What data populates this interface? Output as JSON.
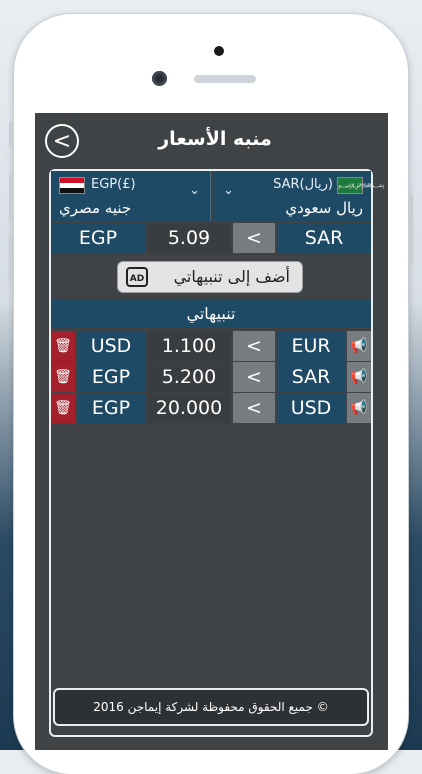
{
  "header": {
    "title": "منبه الأسعار",
    "back_icon": "<"
  },
  "selectors": {
    "left": {
      "code": "EGP(£)",
      "name": "جنيه مصري",
      "flag": "egypt-flag-icon"
    },
    "right": {
      "code": "SAR(ريال)",
      "name": "ريال سعودي",
      "flag": "saudi-flag-icon"
    }
  },
  "converter": {
    "from": "EGP",
    "value": "5.09",
    "op": "<",
    "to": "SAR"
  },
  "add_alert": {
    "label": "أضف إلى تنبيهاتي",
    "icon_text": "AD"
  },
  "alerts_header": "تنبيهاتي",
  "alerts": [
    {
      "left_code": "USD",
      "value": "1.100",
      "op": "<",
      "right_code": "EUR"
    },
    {
      "left_code": "EGP",
      "value": "5.200",
      "op": "<",
      "right_code": "SAR"
    },
    {
      "left_code": "EGP",
      "value": "20.000",
      "op": "<",
      "right_code": "USD"
    }
  ],
  "footer": "جميع الحقوق محفوظة لشركة إيماجن 2016 ©",
  "colors": {
    "primary": "#1f4a66",
    "delete": "#a3202c",
    "background": "#404346"
  }
}
